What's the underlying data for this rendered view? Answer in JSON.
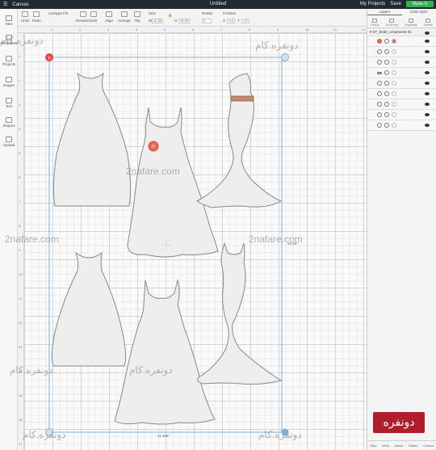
{
  "topbar": {
    "app": "Canvas",
    "title": "Untitled",
    "my_projects": "My Projects",
    "save": "Save",
    "make": "Make It"
  },
  "toolbar": {
    "undo": "Undo",
    "redo": "Redo",
    "linetype": "Linetype",
    "fill": "Fill",
    "deselect": "Deselect",
    "edit": "Edit",
    "align": "Align",
    "arrange": "Arrange",
    "flip": "Flip",
    "size": "Size",
    "width_label": "W",
    "width_value": "11.38",
    "height_label": "H",
    "height_value": "16.29",
    "rotate": "Rotate",
    "rotate_value": "0",
    "position": "Position",
    "x_label": "X",
    "x_value": "1.5",
    "y_label": "Y",
    "y_value": "1.5"
  },
  "sidebar": [
    {
      "label": "New",
      "icon": "plus-icon"
    },
    {
      "label": "Templates",
      "icon": "shirt-icon"
    },
    {
      "label": "Projects",
      "icon": "projects-icon"
    },
    {
      "label": "Images",
      "icon": "image-icon"
    },
    {
      "label": "Text",
      "icon": "text-icon"
    },
    {
      "label": "Shapes",
      "icon": "shapes-icon"
    },
    {
      "label": "Upload",
      "icon": "upload-icon"
    }
  ],
  "ruler": {
    "top": [
      "1",
      "2",
      "3",
      "4",
      "5",
      "6",
      "7",
      "8",
      "9",
      "10",
      "11",
      "12"
    ],
    "left": [
      "1",
      "2",
      "3",
      "4",
      "5",
      "6",
      "7",
      "8",
      "9",
      "10",
      "11",
      "12",
      "13",
      "14",
      "15",
      "16",
      "17"
    ]
  },
  "canvas": {
    "selection_width_label": "11.386\"",
    "selection_height_label": "16.29\"",
    "watermarks": [
      "دونفره.کام",
      "دونفره.کام",
      "2nafare.com",
      "2nafare.com",
      "2nafare.com",
      "دونفره.کام",
      "دونفره.کام",
      "دونفره.کام",
      "دونفره.کام"
    ]
  },
  "colors": {
    "accent_green": "#2fb34a",
    "selection_blue": "#7fb0d8",
    "handle_red": "#e0474c",
    "flower": "#e86b52",
    "belt": "#c28a66",
    "dress_fill": "#eeeeee",
    "dress_stroke": "#888888"
  },
  "layers_panel": {
    "tabs": [
      "Layers",
      "Color Sync"
    ],
    "actions": [
      "Group",
      "UnGroup",
      "Duplicate",
      "Delete"
    ],
    "group_name": "ST_bride_ornaments 01",
    "rows": [
      {
        "thumb": "flower-layer-icon",
        "badge": ""
      },
      {
        "thumb": "dress-layer-icon",
        "badge": ""
      },
      {
        "thumb": "dress-layer-icon",
        "badge": ""
      },
      {
        "thumb": "belt-layer-icon",
        "badge": ""
      },
      {
        "thumb": "dress-layer-icon",
        "badge": ""
      },
      {
        "thumb": "dress-layer-icon",
        "badge": ""
      },
      {
        "thumb": "dress-layer-icon",
        "badge": ""
      },
      {
        "thumb": "dress-layer-icon",
        "badge": ""
      },
      {
        "thumb": "dress-layer-icon",
        "badge": ""
      }
    ],
    "footer": [
      "Slice",
      "Weld",
      "Attach",
      "Flatten",
      "Contour"
    ]
  },
  "brand_logo": "دونفره"
}
